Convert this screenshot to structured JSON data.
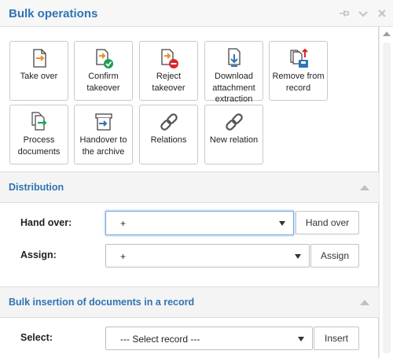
{
  "header": {
    "title": "Bulk operations",
    "icons": [
      "pin-icon",
      "chevron-down-icon",
      "close-icon"
    ]
  },
  "tiles": [
    {
      "id": "take-over",
      "label": "Take over",
      "icon": "take-over-icon"
    },
    {
      "id": "confirm-takeover",
      "label": "Confirm takeover",
      "icon": "confirm-takeover-icon"
    },
    {
      "id": "reject-takeover",
      "label": "Reject takeover",
      "icon": "reject-takeover-icon"
    },
    {
      "id": "download-attachment-extraction",
      "label": "Download attachment extraction",
      "icon": "download-icon"
    },
    {
      "id": "remove-from-record",
      "label": "Remove from record",
      "icon": "remove-from-record-icon"
    },
    {
      "id": "process-documents",
      "label": "Process documents",
      "icon": "process-documents-icon"
    },
    {
      "id": "handover-to-archive",
      "label": "Handover to the archive",
      "icon": "archive-icon"
    },
    {
      "id": "relations",
      "label": "Relations",
      "icon": "link-icon"
    },
    {
      "id": "new-relation",
      "label": "New relation",
      "icon": "link-icon"
    }
  ],
  "distribution": {
    "title": "Distribution",
    "hand_over_label": "Hand over:",
    "hand_over_value": "+",
    "hand_over_button": "Hand over",
    "assign_label": "Assign:",
    "assign_value": "+",
    "assign_button": "Assign"
  },
  "bulk_insertion": {
    "title": "Bulk insertion of documents in a record",
    "select_label": "Select:",
    "select_value": "--- Select record ---",
    "insert_button": "Insert"
  },
  "colors": {
    "accent": "#2f74b5",
    "doc_orange": "#e8912d",
    "success": "#1f9d55",
    "danger": "#d9262c",
    "link": "#555555"
  }
}
